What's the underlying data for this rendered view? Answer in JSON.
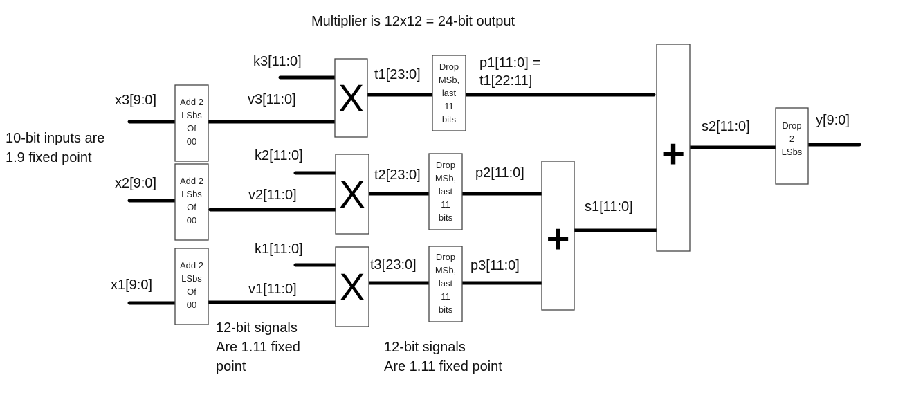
{
  "title": "Multiplier is 12x12 = 24-bit output",
  "notes": {
    "inputs": "10-bit inputs are\n1.9 fixed point",
    "signals_left": "12-bit signals\nAre 1.11 fixed\npoint",
    "signals_right": "12-bit signals\nAre 1.11 fixed point"
  },
  "inputs": [
    {
      "label": "x3[9:0]"
    },
    {
      "label": "x2[9:0]"
    },
    {
      "label": "x1[9:0]"
    }
  ],
  "pad_blocks": [
    {
      "text": "Add 2\nLSbs\nOf\n00"
    },
    {
      "text": "Add 2\nLSbs\nOf\n00"
    },
    {
      "text": "Add 2\nLSbs\nOf\n00"
    }
  ],
  "padded_signals": [
    "v3[11:0]",
    "v2[11:0]",
    "v1[11:0]"
  ],
  "coefficients": [
    "k3[11:0]",
    "k2[11:0]",
    "k1[11:0]"
  ],
  "multipliers": [
    {
      "symbol": "X",
      "output": "t1[23:0]"
    },
    {
      "symbol": "X",
      "output": "t2[23:0]"
    },
    {
      "symbol": "X",
      "output": "t3[23:0]"
    }
  ],
  "truncate_blocks": [
    {
      "text": "Drop\nMSb,\nlast\n11\nbits"
    },
    {
      "text": "Drop\nMSb,\nlast\n11\nbits"
    },
    {
      "text": "Drop\nMSb,\nlast\n11\nbits"
    }
  ],
  "products": [
    "p1[11:0] =\nt1[22:11]",
    "p2[11:0]",
    "p3[11:0]"
  ],
  "adders": [
    {
      "symbol": "+",
      "output": "s1[11:0]"
    },
    {
      "symbol": "+",
      "output": "s2[11:0]"
    }
  ],
  "output_block": {
    "text": "Drop\n2\nLSbs"
  },
  "output": {
    "label": "y[9:0]"
  }
}
